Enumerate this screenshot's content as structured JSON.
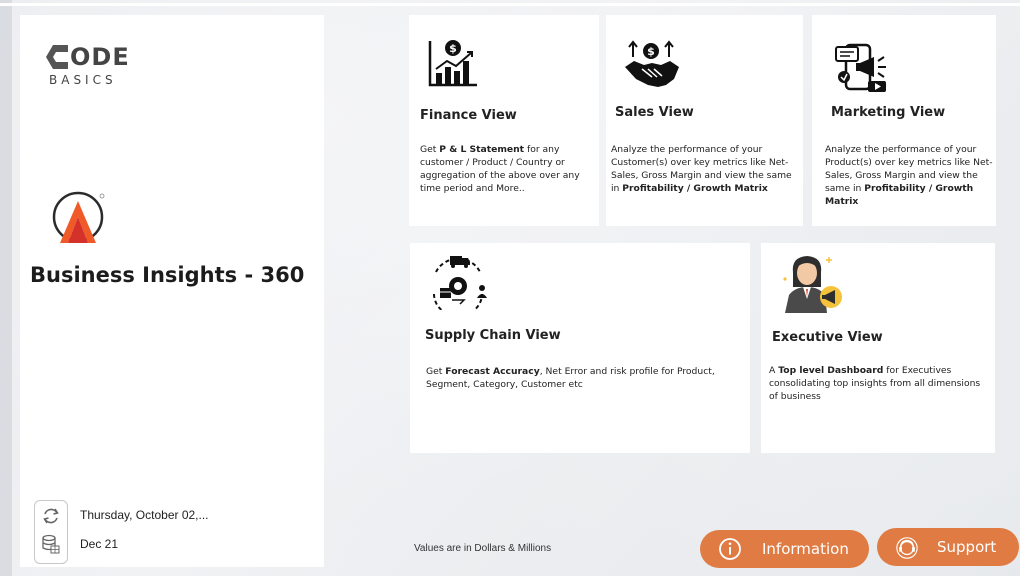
{
  "brand": {
    "logo_top": "ODE",
    "logo_bottom": "BASICS",
    "app_title": "Business Insights - 360"
  },
  "refresh": {
    "last_refresh": "Thursday, October 02,...",
    "data_period": "Dec 21"
  },
  "cards": {
    "finance": {
      "title": "Finance View",
      "d1": "Get ",
      "b1": "P & L Statement",
      "d2": " for any customer / Product / Country  or aggregation of the above over any time period and More.."
    },
    "sales": {
      "title": "Sales View",
      "d1": "Analyze the performance of your Customer(s) over key metrics like Net-Sales, Gross Margin and view the same in ",
      "b1": "Profitability / Growth Matrix"
    },
    "marketing": {
      "title": "Marketing View",
      "d1": "Analyze the performance of your Product(s) over key metrics like Net-Sales, Gross Margin and view the same in ",
      "b1": "Profitability / Growth Matrix"
    },
    "supply_chain": {
      "title": "Supply Chain View",
      "d1": "Get ",
      "b1": "Forecast Accuracy",
      "d2": ", Net Error and risk profile for Product, Segment,  Category, Customer etc"
    },
    "executive": {
      "title": "Executive View",
      "d1": "A ",
      "b1": "Top level Dashboard",
      "d2": " for Executives consolidating top insights from all dimensions of business"
    }
  },
  "footer": {
    "note": "Values are in Dollars & Millions",
    "information_label": "Information",
    "support_label": "Support"
  },
  "colors": {
    "accent": "#e07c43",
    "logo_orange": "#f05a28",
    "logo_red": "#d4312a"
  }
}
